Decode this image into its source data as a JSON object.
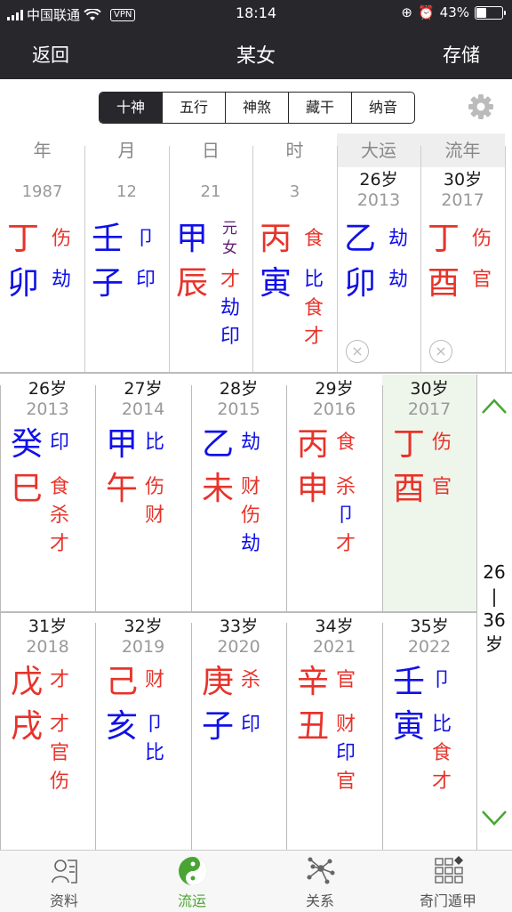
{
  "status_bar": {
    "carrier": "中国联通",
    "vpn": "VPN",
    "time": "18:14",
    "battery": "43%",
    "battery_level": 0.43
  },
  "nav": {
    "back": "返回",
    "title": "某女",
    "save": "存储"
  },
  "segments": [
    {
      "label": "十神",
      "active": true
    },
    {
      "label": "五行",
      "active": false
    },
    {
      "label": "神煞",
      "active": false
    },
    {
      "label": "藏干",
      "active": false
    },
    {
      "label": "纳音",
      "active": false
    }
  ],
  "pillars": [
    {
      "header": "年",
      "date": "1987",
      "stem": {
        "char": "丁",
        "color": "red",
        "god": "伤",
        "god_color": "red"
      },
      "branch": {
        "char": "卯",
        "color": "blue",
        "gods": [
          {
            "t": "劫",
            "c": "blue"
          }
        ]
      }
    },
    {
      "header": "月",
      "date": "12",
      "stem": {
        "char": "壬",
        "color": "blue",
        "god": "卩",
        "god_color": "blue"
      },
      "branch": {
        "char": "子",
        "color": "blue",
        "gods": [
          {
            "t": "印",
            "c": "blue"
          }
        ]
      }
    },
    {
      "header": "日",
      "date": "21",
      "stem": {
        "char": "甲",
        "color": "blue",
        "god": "元女",
        "god_color": "purple"
      },
      "branch": {
        "char": "辰",
        "color": "red",
        "gods": [
          {
            "t": "才",
            "c": "red"
          },
          {
            "t": "劫",
            "c": "blue"
          },
          {
            "t": "印",
            "c": "blue"
          }
        ]
      }
    },
    {
      "header": "时",
      "date": "3",
      "stem": {
        "char": "丙",
        "color": "red",
        "god": "食",
        "god_color": "red"
      },
      "branch": {
        "char": "寅",
        "color": "blue",
        "gods": [
          {
            "t": "比",
            "c": "blue"
          },
          {
            "t": "食",
            "c": "red"
          },
          {
            "t": "才",
            "c": "red"
          }
        ]
      }
    },
    {
      "header": "大运",
      "age": "26岁",
      "date": "2013",
      "stem": {
        "char": "乙",
        "color": "blue",
        "god": "劫",
        "god_color": "blue"
      },
      "branch": {
        "char": "卯",
        "color": "blue",
        "gods": [
          {
            "t": "劫",
            "c": "blue"
          }
        ]
      },
      "close": "⊗"
    },
    {
      "header": "流年",
      "age": "30岁",
      "date": "2017",
      "stem": {
        "char": "丁",
        "color": "red",
        "god": "伤",
        "god_color": "red"
      },
      "branch": {
        "char": "酉",
        "color": "red",
        "gods": [
          {
            "t": "官",
            "c": "red"
          }
        ]
      },
      "close": "⊗"
    }
  ],
  "years": [
    {
      "age": "26岁",
      "year": "2013",
      "stem": {
        "char": "癸",
        "color": "blue",
        "god": "印",
        "god_color": "blue"
      },
      "branch": {
        "char": "巳",
        "color": "red",
        "gods": [
          {
            "t": "食",
            "c": "red"
          },
          {
            "t": "杀",
            "c": "red"
          },
          {
            "t": "才",
            "c": "red"
          }
        ]
      }
    },
    {
      "age": "27岁",
      "year": "2014",
      "stem": {
        "char": "甲",
        "color": "blue",
        "god": "比",
        "god_color": "blue"
      },
      "branch": {
        "char": "午",
        "color": "red",
        "gods": [
          {
            "t": "伤",
            "c": "red"
          },
          {
            "t": "财",
            "c": "red"
          }
        ]
      }
    },
    {
      "age": "28岁",
      "year": "2015",
      "stem": {
        "char": "乙",
        "color": "blue",
        "god": "劫",
        "god_color": "blue"
      },
      "branch": {
        "char": "未",
        "color": "red",
        "gods": [
          {
            "t": "财",
            "c": "red"
          },
          {
            "t": "伤",
            "c": "red"
          },
          {
            "t": "劫",
            "c": "blue"
          }
        ]
      }
    },
    {
      "age": "29岁",
      "year": "2016",
      "stem": {
        "char": "丙",
        "color": "red",
        "god": "食",
        "god_color": "red"
      },
      "branch": {
        "char": "申",
        "color": "red",
        "gods": [
          {
            "t": "杀",
            "c": "red"
          },
          {
            "t": "卩",
            "c": "blue"
          },
          {
            "t": "才",
            "c": "red"
          }
        ]
      }
    },
    {
      "age": "30岁",
      "year": "2017",
      "highlighted": true,
      "stem": {
        "char": "丁",
        "color": "red",
        "god": "伤",
        "god_color": "red"
      },
      "branch": {
        "char": "酉",
        "color": "red",
        "gods": [
          {
            "t": "官",
            "c": "red"
          }
        ]
      }
    },
    {
      "age": "31岁",
      "year": "2018",
      "stem": {
        "char": "戊",
        "color": "red",
        "god": "才",
        "god_color": "red"
      },
      "branch": {
        "char": "戌",
        "color": "red",
        "gods": [
          {
            "t": "才",
            "c": "red"
          },
          {
            "t": "官",
            "c": "red"
          },
          {
            "t": "伤",
            "c": "red"
          }
        ]
      }
    },
    {
      "age": "32岁",
      "year": "2019",
      "stem": {
        "char": "己",
        "color": "red",
        "god": "财",
        "god_color": "red"
      },
      "branch": {
        "char": "亥",
        "color": "blue",
        "gods": [
          {
            "t": "卩",
            "c": "blue"
          },
          {
            "t": "比",
            "c": "blue"
          }
        ]
      }
    },
    {
      "age": "33岁",
      "year": "2020",
      "stem": {
        "char": "庚",
        "color": "red",
        "god": "杀",
        "god_color": "red"
      },
      "branch": {
        "char": "子",
        "color": "blue",
        "gods": [
          {
            "t": "印",
            "c": "blue"
          }
        ]
      }
    },
    {
      "age": "34岁",
      "year": "2021",
      "stem": {
        "char": "辛",
        "color": "red",
        "god": "官",
        "god_color": "red"
      },
      "branch": {
        "char": "丑",
        "color": "red",
        "gods": [
          {
            "t": "财",
            "c": "red"
          },
          {
            "t": "印",
            "c": "blue"
          },
          {
            "t": "官",
            "c": "red"
          }
        ]
      }
    },
    {
      "age": "35岁",
      "year": "2022",
      "stem": {
        "char": "壬",
        "color": "blue",
        "god": "卩",
        "god_color": "blue"
      },
      "branch": {
        "char": "寅",
        "color": "blue",
        "gods": [
          {
            "t": "比",
            "c": "blue"
          },
          {
            "t": "食",
            "c": "red"
          },
          {
            "t": "才",
            "c": "red"
          }
        ]
      }
    }
  ],
  "range": {
    "start": "26",
    "sep": "|",
    "end": "36",
    "unit": "岁"
  },
  "tabs": [
    {
      "label": "资料",
      "icon": "profile-icon",
      "active": false
    },
    {
      "label": "流运",
      "icon": "yin-yang-icon",
      "active": true
    },
    {
      "label": "关系",
      "icon": "network-icon",
      "active": false
    },
    {
      "label": "奇门遁甲",
      "icon": "grid-icon",
      "active": false
    }
  ],
  "colors": {
    "red": "#e8332a",
    "blue": "#1010e8",
    "purple": "#5e1f72",
    "accent_green": "#4aa434",
    "dark_bar": "#27272c",
    "highlight": "#eef6ec"
  }
}
